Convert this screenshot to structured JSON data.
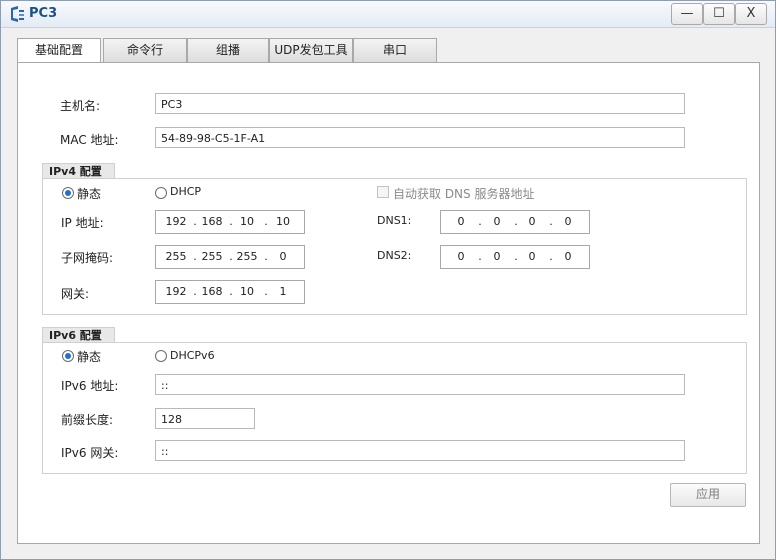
{
  "window": {
    "title": "PC3",
    "controls": {
      "minimize": "—",
      "maximize": "☐",
      "close": "X"
    }
  },
  "tabs": [
    {
      "label": "基础配置",
      "active": true
    },
    {
      "label": "命令行",
      "active": false
    },
    {
      "label": "组播",
      "active": false
    },
    {
      "label": "UDP发包工具",
      "active": false
    },
    {
      "label": "串口",
      "active": false
    }
  ],
  "basic": {
    "hostname_label": "主机名:",
    "hostname_value": "PC3",
    "mac_label": "MAC 地址:",
    "mac_value": "54-89-98-C5-1F-A1"
  },
  "ipv4": {
    "group_title": "IPv4 配置",
    "static_label": "静态",
    "dhcp_label": "DHCP",
    "auto_dns_label": "自动获取 DNS 服务器地址",
    "mode": "static",
    "ip_label": "IP 地址:",
    "ip": [
      "192",
      "168",
      "10",
      "10"
    ],
    "mask_label": "子网掩码:",
    "mask": [
      "255",
      "255",
      "255",
      "0"
    ],
    "gateway_label": "网关:",
    "gateway": [
      "192",
      "168",
      "10",
      "1"
    ],
    "dns1_label": "DNS1:",
    "dns1": [
      "0",
      "0",
      "0",
      "0"
    ],
    "dns2_label": "DNS2:",
    "dns2": [
      "0",
      "0",
      "0",
      "0"
    ]
  },
  "ipv6": {
    "group_title": "IPv6 配置",
    "static_label": "静态",
    "dhcp_label": "DHCPv6",
    "mode": "static",
    "address_label": "IPv6 地址:",
    "address_value": "::",
    "prefix_label": "前缀长度:",
    "prefix_value": "128",
    "gateway_label": "IPv6 网关:",
    "gateway_value": "::"
  },
  "apply_label": "应用",
  "colors": {
    "title_text": "#1b4f8a",
    "radio_selected": "#1f6fd6"
  }
}
